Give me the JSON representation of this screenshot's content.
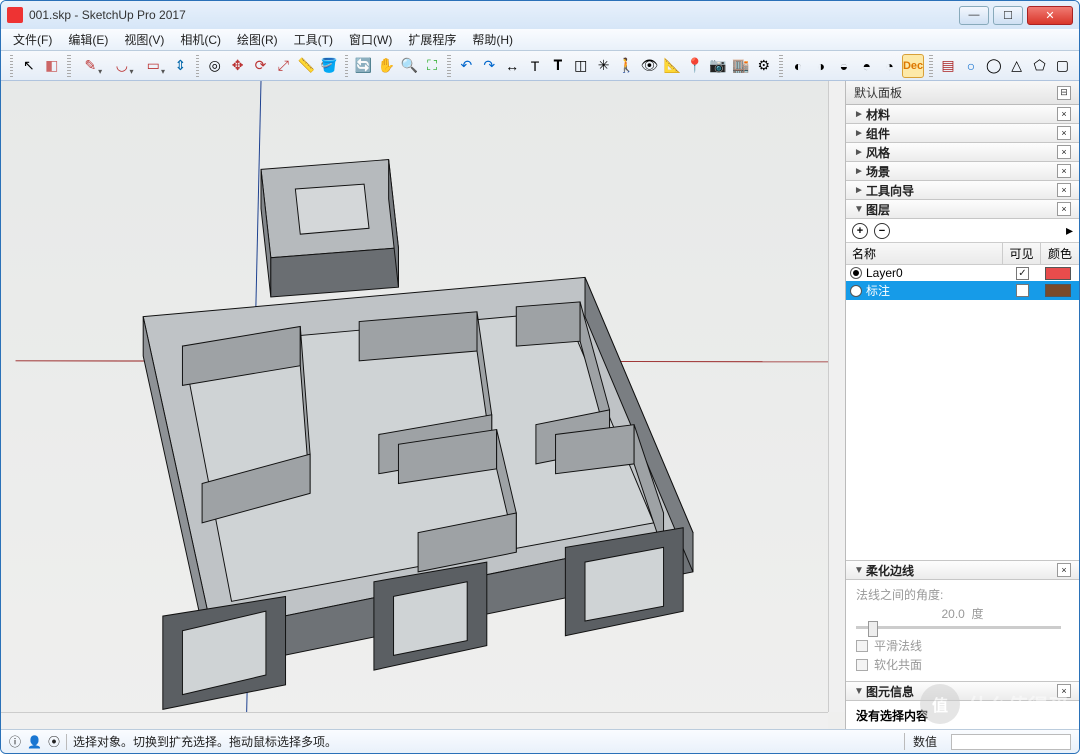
{
  "window": {
    "title": "001.skp - SketchUp Pro 2017"
  },
  "menu": [
    "文件(F)",
    "编辑(E)",
    "视图(V)",
    "相机(C)",
    "绘图(R)",
    "工具(T)",
    "窗口(W)",
    "扩展程序",
    "帮助(H)"
  ],
  "toolbar_icons": [
    "select",
    "eraser",
    "pencil",
    "arc",
    "rect",
    "pushpull",
    "offset",
    "move",
    "rotate",
    "scale",
    "tape",
    "paint",
    "orbit",
    "pan",
    "zoom",
    "zoom-ext",
    "undo",
    "redo",
    "dimension",
    "text",
    "3dtext",
    "section",
    "axes",
    "walk",
    "look",
    "position",
    "add-loc",
    "photo",
    "3dwh",
    "ext-wh",
    "solid-union",
    "solid-sub",
    "solid-int",
    "solid-trim",
    "solid-split",
    "dec",
    "brick",
    "circle",
    "cyl",
    "cone",
    "poly",
    "cube"
  ],
  "tray": {
    "title": "默认面板"
  },
  "panels": [
    {
      "label": "材料",
      "expanded": false
    },
    {
      "label": "组件",
      "expanded": false
    },
    {
      "label": "风格",
      "expanded": false
    },
    {
      "label": "场景",
      "expanded": false
    },
    {
      "label": "工具向导",
      "expanded": false
    },
    {
      "label": "图层",
      "expanded": true
    },
    {
      "label": "柔化边线",
      "expanded": true
    },
    {
      "label": "图元信息",
      "expanded": true
    }
  ],
  "layers": {
    "cols": {
      "name": "名称",
      "visible": "可见",
      "color": "颜色"
    },
    "rows": [
      {
        "name": "Layer0",
        "active": true,
        "visible": true,
        "color": "#e84c4c",
        "selected": false
      },
      {
        "name": "标注",
        "active": false,
        "visible": false,
        "color": "#7a4a2a",
        "selected": true
      }
    ]
  },
  "soften": {
    "label": "法线之间的角度:",
    "value": "20.0",
    "unit": "度",
    "smooth": "平滑法线",
    "coplanar": "软化共面"
  },
  "entity": {
    "none": "没有选择内容"
  },
  "status": {
    "hint": "选择对象。切换到扩充选择。拖动鼠标选择多项。",
    "measure_label": "数值"
  },
  "watermark": "什么值得买"
}
